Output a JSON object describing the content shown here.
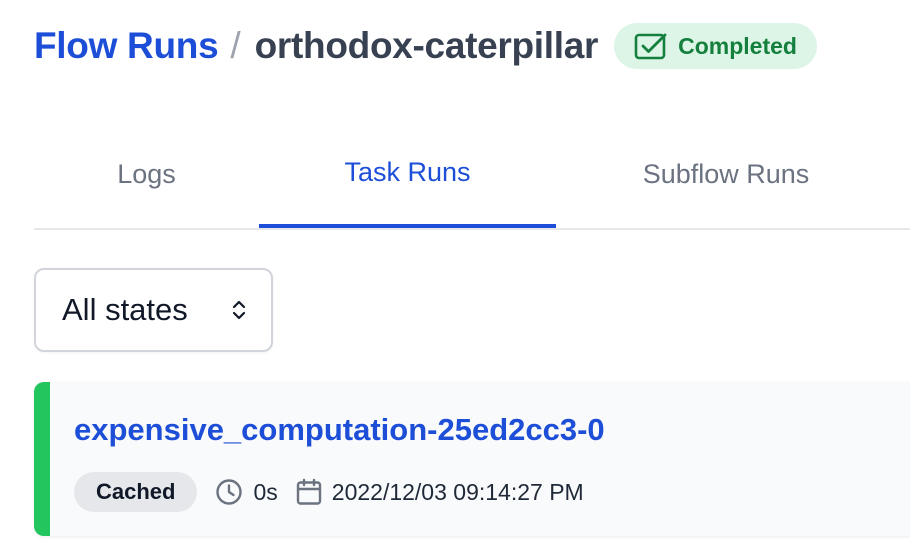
{
  "breadcrumb": {
    "parent_label": "Flow Runs",
    "separator": "/",
    "current_label": "orthodox-caterpillar"
  },
  "status": {
    "label": "Completed",
    "icon": "check-square-icon",
    "color": "#15803d",
    "background": "#dcf5e6"
  },
  "tabs": [
    {
      "label": "Logs",
      "active": false
    },
    {
      "label": "Task Runs",
      "active": true
    },
    {
      "label": "Subflow Runs",
      "active": false
    }
  ],
  "filter": {
    "selected": "All states",
    "icon": "chevron-updown-icon"
  },
  "task_runs": [
    {
      "name": "expensive_computation-25ed2cc3-0",
      "state": "Cached",
      "state_color": "#22c55e",
      "duration": "0s",
      "start_time": "2022/12/03 09:14:27 PM"
    }
  ],
  "colors": {
    "link": "#1d4ed8",
    "accent_success": "#22c55e"
  }
}
